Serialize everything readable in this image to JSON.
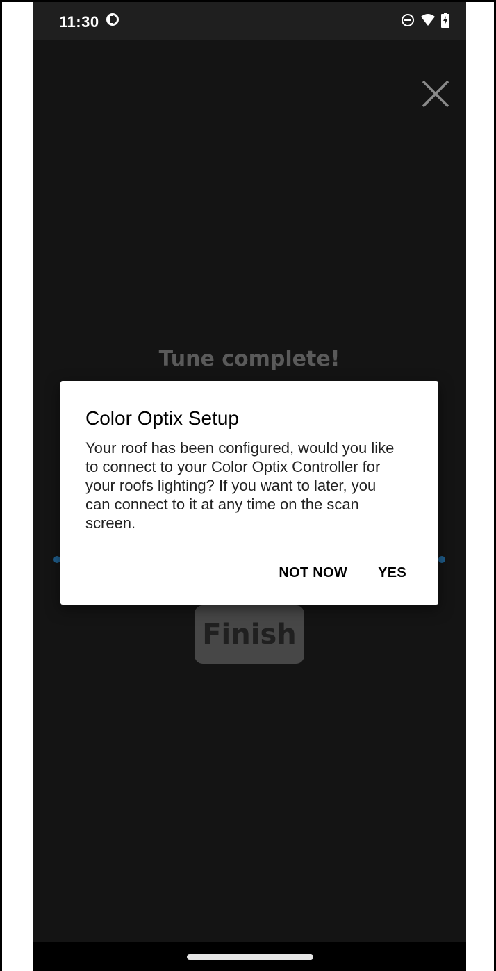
{
  "status_bar": {
    "time": "11:30",
    "app_icon": "circle-half-icon",
    "icons": [
      "dnd-icon",
      "wifi-icon",
      "battery-charging-icon"
    ]
  },
  "screen": {
    "title": "Tune complete!",
    "finish_label": "Finish",
    "close_icon": "close-icon"
  },
  "dialog": {
    "title": "Color Optix Setup",
    "body": "Your roof has been configured, would you like to connect to your Color Optix Controller for your roofs lighting? If you want to later, you can connect to it at any time on the scan screen.",
    "not_now_label": "NOT NOW",
    "yes_label": "YES"
  },
  "colors": {
    "background": "#141414",
    "accent": "#1f5e8c",
    "dialog_bg": "#ffffff"
  }
}
